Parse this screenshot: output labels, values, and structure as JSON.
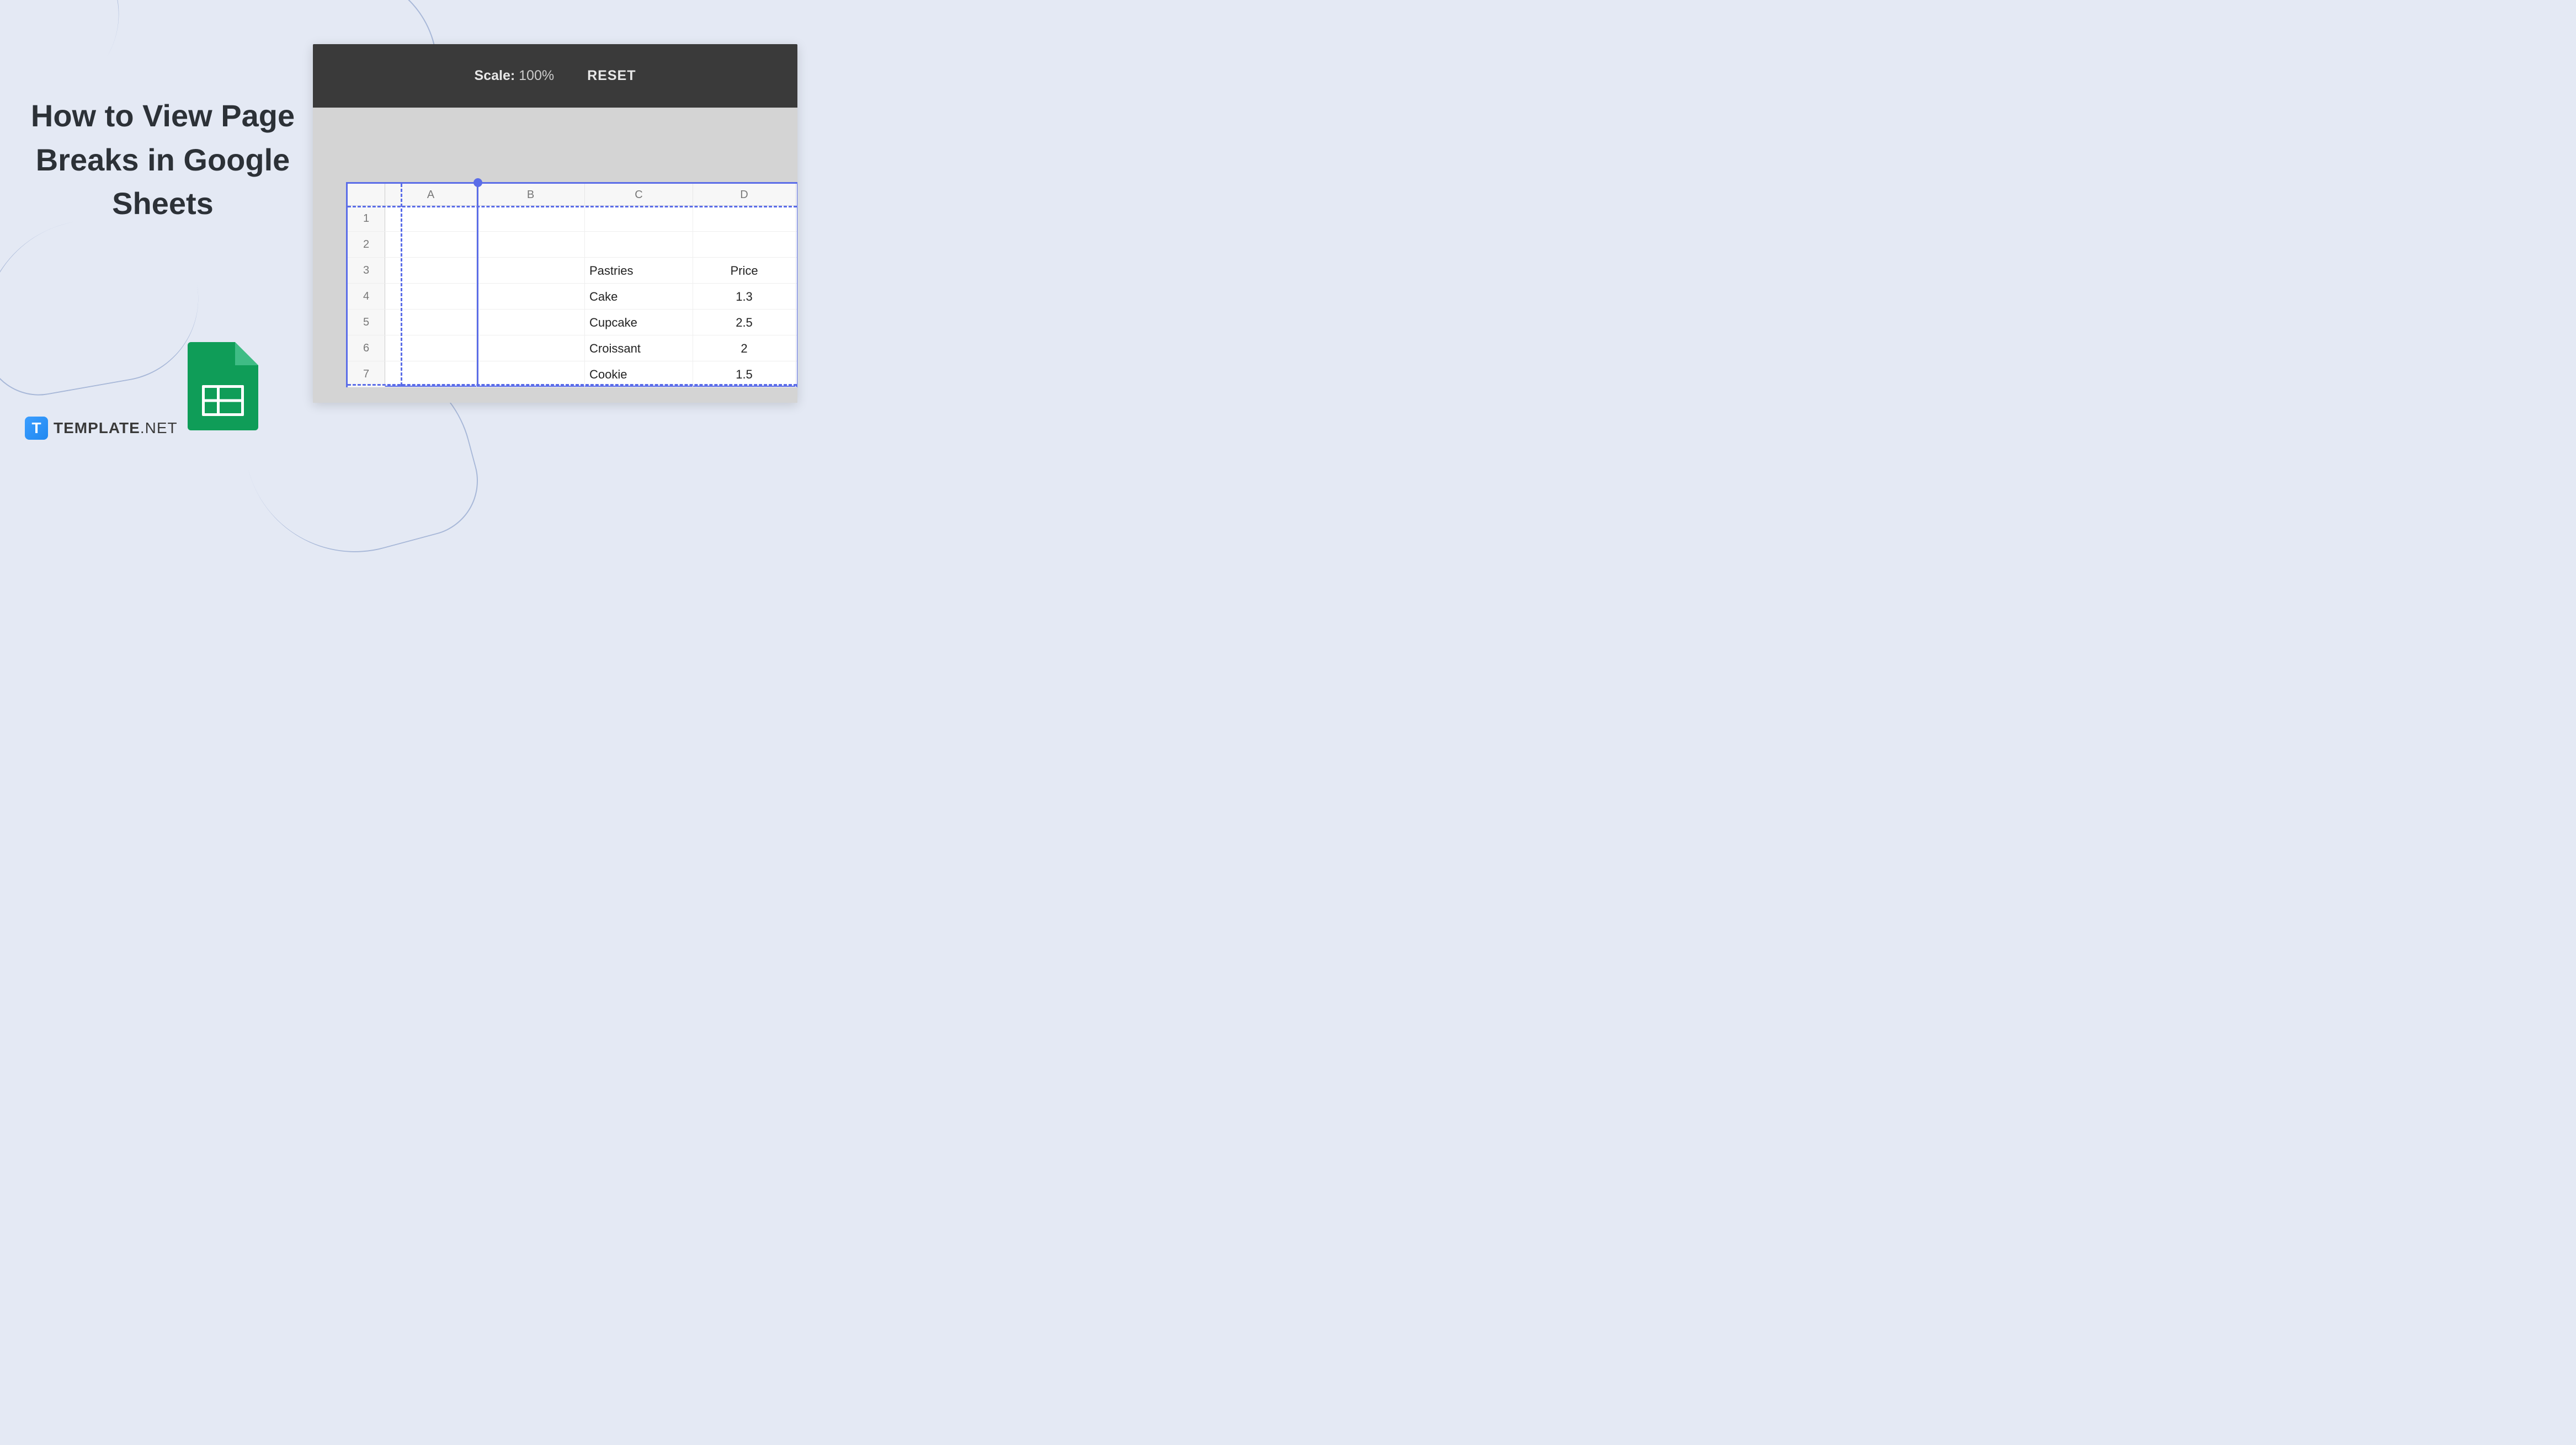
{
  "title": "How to View Page Breaks in Google Sheets",
  "logo": {
    "icon_letter": "T",
    "text": "TEMPLATE",
    "suffix": ".NET"
  },
  "toolbar": {
    "scale_label": "Scale:",
    "scale_value": "100%",
    "reset_label": "RESET"
  },
  "columns": [
    "A",
    "B",
    "C",
    "D"
  ],
  "rows": [
    {
      "num": "1",
      "a": "",
      "b": "",
      "c": "",
      "d": ""
    },
    {
      "num": "2",
      "a": "",
      "b": "",
      "c": "",
      "d": ""
    },
    {
      "num": "3",
      "a": "",
      "b": "",
      "c": "Pastries",
      "d": "Price"
    },
    {
      "num": "4",
      "a": "",
      "b": "",
      "c": "Cake",
      "d": "1.3"
    },
    {
      "num": "5",
      "a": "",
      "b": "",
      "c": "Cupcake",
      "d": "2.5"
    },
    {
      "num": "6",
      "a": "",
      "b": "",
      "c": "Croissant",
      "d": "2"
    },
    {
      "num": "7",
      "a": "",
      "b": "",
      "c": "Cookie",
      "d": "1.5"
    }
  ]
}
